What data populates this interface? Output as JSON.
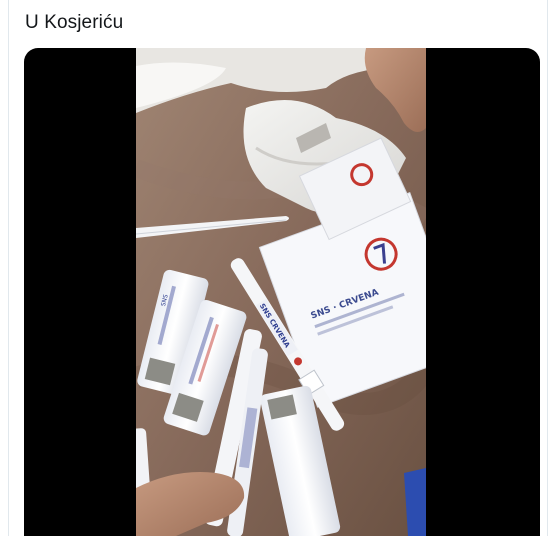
{
  "tweet": {
    "text": "U Kosjeriću"
  },
  "media": {
    "type": "video",
    "letterbox_color": "#000000"
  }
}
